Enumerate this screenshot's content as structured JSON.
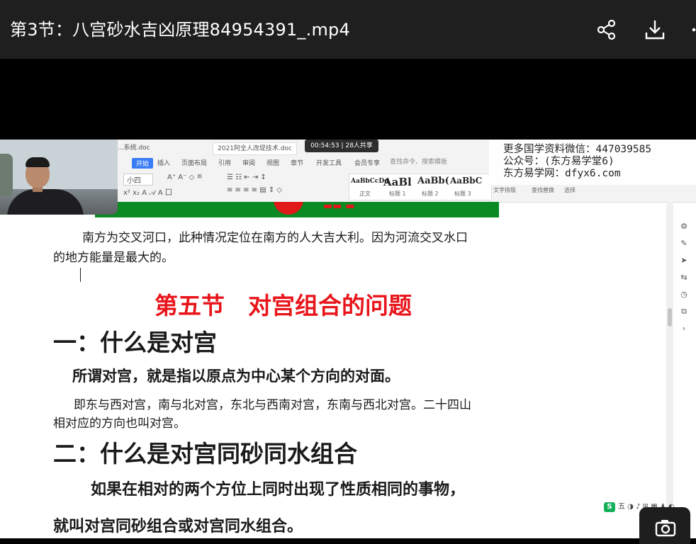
{
  "player": {
    "title": "第3节：八宫砂水吉凶原理84954391_.mp4",
    "share_icon": "share-icon",
    "download_icon": "download-icon",
    "more_icon": "more-icon",
    "camera_icon": "camera-icon"
  },
  "wps": {
    "file_tabs": [
      "...系统.doc",
      "2021阿全人改堤技术.doc"
    ],
    "meeting_timer": "00:54:53 | 28人共享",
    "ribbon_tabs": [
      "开始",
      "插入",
      "页面布局",
      "引用",
      "审阅",
      "视图",
      "章节",
      "开发工具",
      "会员专享"
    ],
    "search_placeholder": "查找命令、搜索模板",
    "font_name": "小四",
    "style_samples": [
      "AaBbCcDd",
      "AaBl",
      "AaBb(",
      "AaBbC"
    ],
    "style_names": [
      "正文",
      "标题 1",
      "标题 2",
      "标题 3"
    ],
    "right_tools": [
      "文字排版",
      "查找替换",
      "选择"
    ],
    "tray_label": "五"
  },
  "watermark": {
    "line1": "更多国学资料微信：447039585",
    "line2": "公众号：(东方易学堂6)",
    "line3": "东方易学网：dfyx6.com"
  },
  "document": {
    "para1_line1": "南方为交叉河口，此种情况定位在南方的人大吉大利。因为河流交叉水口",
    "para1_line2": "的地方能量是最大的。",
    "section_title": "第五节　对宫组合的问题",
    "heading1": "一：什么是对宫",
    "def_line": "所谓对宫，就是指以原点为中心某个方向的对面。",
    "para2_line1": "即东与西对宫，南与北对宫，东北与西南对宫，东南与西北对宫。二十四山",
    "para2_line2": "相对应的方向也叫对宫。",
    "heading2": "二：什么是对宫同砂同水组合",
    "para3_line1": "如果在相对的两个方位上同时出现了性质相同的事物，",
    "para3_line2": "就叫对宫同砂组合或对宫同水组合。"
  }
}
